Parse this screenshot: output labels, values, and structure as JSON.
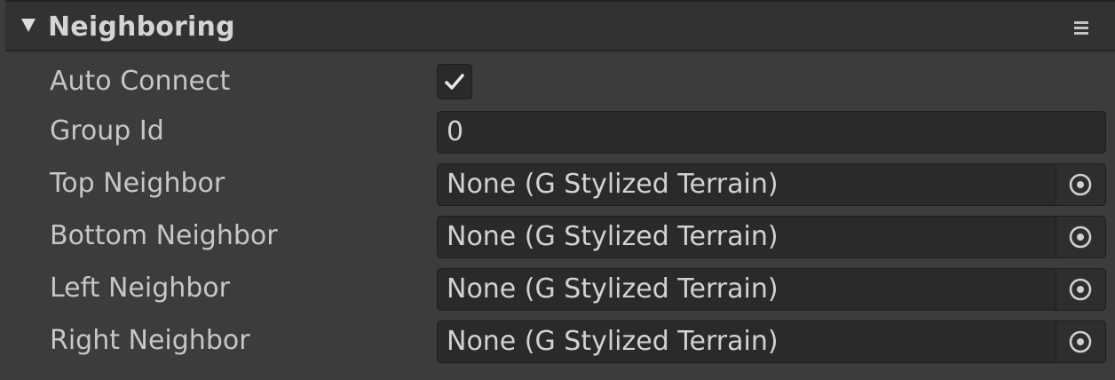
{
  "section": {
    "title": "Neighboring"
  },
  "fields": {
    "auto_connect": {
      "label": "Auto Connect",
      "checked": true
    },
    "group_id": {
      "label": "Group Id",
      "value": "0"
    },
    "top_neighbor": {
      "label": "Top Neighbor",
      "value": "None (G Stylized Terrain)"
    },
    "bottom_neighbor": {
      "label": "Bottom Neighbor",
      "value": "None (G Stylized Terrain)"
    },
    "left_neighbor": {
      "label": "Left Neighbor",
      "value": "None (G Stylized Terrain)"
    },
    "right_neighbor": {
      "label": "Right Neighbor",
      "value": "None (G Stylized Terrain)"
    }
  },
  "icons": {
    "foldout": "triangle-down-icon",
    "menu": "menu-icon",
    "checkmark": "checkmark-icon",
    "object_picker": "object-picker-icon"
  },
  "colors": {
    "background": "#3c3c3c",
    "header": "#323232",
    "field": "#2a2a2a",
    "text": "#c6c6c6"
  }
}
